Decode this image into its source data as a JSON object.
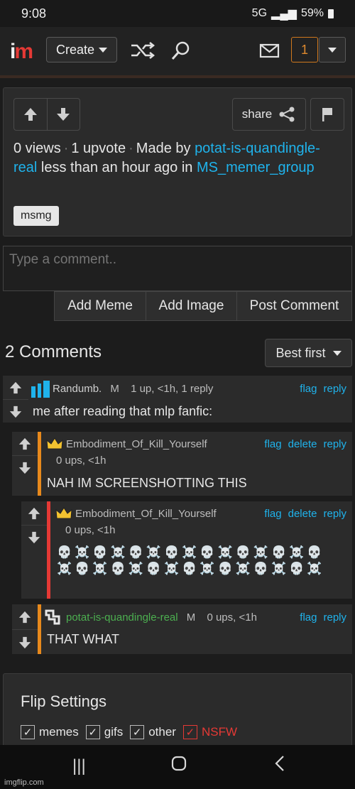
{
  "status_bar": {
    "time": "9:08",
    "network": "5G",
    "battery": "59%"
  },
  "header": {
    "logo_main": "i",
    "logo_rest": "m",
    "create_label": "Create",
    "notification_count": "1"
  },
  "meme_info": {
    "share_label": "share",
    "views": "0 views",
    "upvotes": "1 upvote",
    "made_by_prefix": "Made by",
    "author": "potat-is-quandingle-real",
    "time_text": "less than an hour ago in",
    "stream": "MS_memer_group",
    "tag": "msmg"
  },
  "comment_form": {
    "placeholder": "Type a comment..",
    "add_meme": "Add Meme",
    "add_image": "Add Image",
    "post_comment": "Post Comment"
  },
  "comments_section": {
    "count_label": "2 Comments",
    "sort_label": "Best first",
    "comments": [
      {
        "username": "Randumb.",
        "badge": "M",
        "meta": "1 up, <1h, 1 reply",
        "flag": "flag",
        "reply": "reply",
        "text": "me after reading that mlp fanfic:"
      },
      {
        "username": "Embodiment_Of_Kill_Yourself",
        "meta": "0 ups, <1h",
        "flag": "flag",
        "delete": "delete",
        "reply": "reply",
        "text": "NAH IM SCREENSHOTTING THIS"
      },
      {
        "username": "Embodiment_Of_Kill_Yourself",
        "meta": "0 ups, <1h",
        "flag": "flag",
        "delete": "delete",
        "reply": "reply",
        "text": "💀☠️💀☠️💀☠️💀☠️💀☠️💀☠️💀☠️💀☠️💀☠️💀☠️💀☠️💀☠️💀☠️💀☠️💀☠️"
      },
      {
        "username": "potat-is-quandingle-real",
        "badge": "M",
        "meta": "0 ups, <1h",
        "flag": "flag",
        "reply": "reply",
        "text": "THAT WHAT"
      }
    ]
  },
  "flip_settings": {
    "title": "Flip Settings",
    "options": [
      {
        "label": "memes",
        "checked": true
      },
      {
        "label": "gifs",
        "checked": true
      },
      {
        "label": "other",
        "checked": true
      },
      {
        "label": "NSFW",
        "checked": true
      }
    ]
  },
  "colors": {
    "link": "#1fb3ec",
    "accent_orange": "#e8891c",
    "accent_red": "#e53935",
    "username_green": "#4caf50"
  },
  "watermark": "imgflip.com"
}
